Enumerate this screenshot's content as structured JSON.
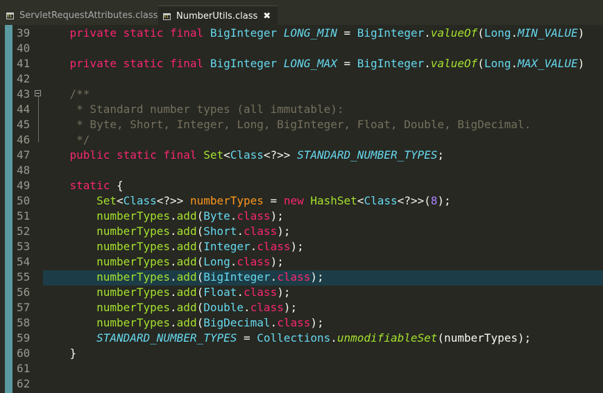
{
  "tabs": [
    {
      "label": "ServletRequestAttributes.class",
      "active": false
    },
    {
      "label": "NumberUtils.class",
      "active": true,
      "close": "✖"
    }
  ],
  "editor": {
    "current_line": "55",
    "lines": [
      {
        "n": "39",
        "t": [
          [
            "kw",
            "    private static final "
          ],
          [
            "ty",
            "BigInteger "
          ],
          [
            "cst",
            "LONG_MIN"
          ],
          [
            "pl",
            " = "
          ],
          [
            "ty",
            "BigInteger"
          ],
          [
            "pl",
            "."
          ],
          [
            "mti",
            "valueOf"
          ],
          [
            "pl",
            "("
          ],
          [
            "ty",
            "Long"
          ],
          [
            "pl",
            "."
          ],
          [
            "cst",
            "MIN_VALUE"
          ],
          [
            "pl",
            ")"
          ]
        ]
      },
      {
        "n": "40",
        "t": []
      },
      {
        "n": "41",
        "t": [
          [
            "kw",
            "    private static final "
          ],
          [
            "ty",
            "BigInteger "
          ],
          [
            "cst",
            "LONG_MAX"
          ],
          [
            "pl",
            " = "
          ],
          [
            "ty",
            "BigInteger"
          ],
          [
            "pl",
            "."
          ],
          [
            "mti",
            "valueOf"
          ],
          [
            "pl",
            "("
          ],
          [
            "ty",
            "Long"
          ],
          [
            "pl",
            "."
          ],
          [
            "cst",
            "MAX_VALUE"
          ],
          [
            "pl",
            ")"
          ]
        ]
      },
      {
        "n": "42",
        "t": []
      },
      {
        "n": "43",
        "t": [
          [
            "cm",
            "    /**"
          ]
        ]
      },
      {
        "n": "44",
        "t": [
          [
            "cm",
            "     * Standard number types (all immutable):"
          ]
        ]
      },
      {
        "n": "45",
        "t": [
          [
            "cm",
            "     * Byte, Short, Integer, Long, BigInteger, Float, Double, BigDecimal."
          ]
        ]
      },
      {
        "n": "46",
        "t": [
          [
            "cm",
            "     */"
          ]
        ]
      },
      {
        "n": "47",
        "t": [
          [
            "kw",
            "    public static final "
          ],
          [
            "mt",
            "Set"
          ],
          [
            "pl",
            "<"
          ],
          [
            "ty",
            "Class"
          ],
          [
            "pl",
            "<?>> "
          ],
          [
            "cst",
            "STANDARD_NUMBER_TYPES"
          ],
          [
            "pl",
            ";"
          ]
        ]
      },
      {
        "n": "48",
        "t": []
      },
      {
        "n": "49",
        "t": [
          [
            "kw",
            "    static "
          ],
          [
            "pl",
            "{"
          ]
        ]
      },
      {
        "n": "50",
        "t": [
          [
            "mt",
            "        Set"
          ],
          [
            "pl",
            "<"
          ],
          [
            "ty",
            "Class"
          ],
          [
            "pl",
            "<?>> "
          ],
          [
            "vr",
            "numberTypes"
          ],
          [
            "pl",
            " = "
          ],
          [
            "kw",
            "new "
          ],
          [
            "mt",
            "HashSet"
          ],
          [
            "pl",
            "<"
          ],
          [
            "ty",
            "Class"
          ],
          [
            "pl",
            "<?>>("
          ],
          [
            "num",
            "8"
          ],
          [
            "pl",
            ");"
          ]
        ]
      },
      {
        "n": "51",
        "t": [
          [
            "mt",
            "        numberTypes"
          ],
          [
            "pl",
            "."
          ],
          [
            "mt",
            "add"
          ],
          [
            "pl",
            "("
          ],
          [
            "ty",
            "Byte"
          ],
          [
            "pl",
            "."
          ],
          [
            "kw",
            "class"
          ],
          [
            "pl",
            ");"
          ]
        ]
      },
      {
        "n": "52",
        "t": [
          [
            "mt",
            "        numberTypes"
          ],
          [
            "pl",
            "."
          ],
          [
            "mt",
            "add"
          ],
          [
            "pl",
            "("
          ],
          [
            "ty",
            "Short"
          ],
          [
            "pl",
            "."
          ],
          [
            "kw",
            "class"
          ],
          [
            "pl",
            ");"
          ]
        ]
      },
      {
        "n": "53",
        "t": [
          [
            "mt",
            "        numberTypes"
          ],
          [
            "pl",
            "."
          ],
          [
            "mt",
            "add"
          ],
          [
            "pl",
            "("
          ],
          [
            "ty",
            "Integer"
          ],
          [
            "pl",
            "."
          ],
          [
            "kw",
            "class"
          ],
          [
            "pl",
            ");"
          ]
        ]
      },
      {
        "n": "54",
        "t": [
          [
            "mt",
            "        numberTypes"
          ],
          [
            "pl",
            "."
          ],
          [
            "mt",
            "add"
          ],
          [
            "pl",
            "("
          ],
          [
            "ty",
            "Long"
          ],
          [
            "pl",
            "."
          ],
          [
            "kw",
            "class"
          ],
          [
            "pl",
            ");"
          ]
        ]
      },
      {
        "n": "55",
        "t": [
          [
            "mt",
            "        numberTypes"
          ],
          [
            "pl",
            "."
          ],
          [
            "mt",
            "add"
          ],
          [
            "pl",
            "("
          ],
          [
            "ty",
            "BigInteger"
          ],
          [
            "pl",
            "."
          ],
          [
            "kw",
            "class"
          ],
          [
            "pl",
            ");"
          ]
        ]
      },
      {
        "n": "56",
        "t": [
          [
            "mt",
            "        numberTypes"
          ],
          [
            "pl",
            "."
          ],
          [
            "mt",
            "add"
          ],
          [
            "pl",
            "("
          ],
          [
            "ty",
            "Float"
          ],
          [
            "pl",
            "."
          ],
          [
            "kw",
            "class"
          ],
          [
            "pl",
            ");"
          ]
        ]
      },
      {
        "n": "57",
        "t": [
          [
            "mt",
            "        numberTypes"
          ],
          [
            "pl",
            "."
          ],
          [
            "mt",
            "add"
          ],
          [
            "pl",
            "("
          ],
          [
            "ty",
            "Double"
          ],
          [
            "pl",
            "."
          ],
          [
            "kw",
            "class"
          ],
          [
            "pl",
            ");"
          ]
        ]
      },
      {
        "n": "58",
        "t": [
          [
            "mt",
            "        numberTypes"
          ],
          [
            "pl",
            "."
          ],
          [
            "mt",
            "add"
          ],
          [
            "pl",
            "("
          ],
          [
            "ty",
            "BigDecimal"
          ],
          [
            "pl",
            "."
          ],
          [
            "kw",
            "class"
          ],
          [
            "pl",
            ");"
          ]
        ]
      },
      {
        "n": "59",
        "t": [
          [
            "cst",
            "        STANDARD_NUMBER_TYPES"
          ],
          [
            "pl",
            " = "
          ],
          [
            "ty",
            "Collections"
          ],
          [
            "pl",
            "."
          ],
          [
            "mti",
            "unmodifiableSet"
          ],
          [
            "pl",
            "(numberTypes);"
          ]
        ]
      },
      {
        "n": "60",
        "t": [
          [
            "pl",
            "    }"
          ]
        ]
      },
      {
        "n": "61",
        "t": []
      },
      {
        "n": "62",
        "t": []
      }
    ]
  },
  "colors": {
    "background": "#272822",
    "keyword": "#f92672",
    "type": "#66d9ef",
    "method": "#a6e22e",
    "comment": "#75715e",
    "variable": "#fd971f",
    "number": "#ae81ff",
    "current_line": "#1c3d47"
  },
  "icons": {
    "tab_icon": "class-file-icon",
    "fold": "fold-collapse-icon"
  }
}
